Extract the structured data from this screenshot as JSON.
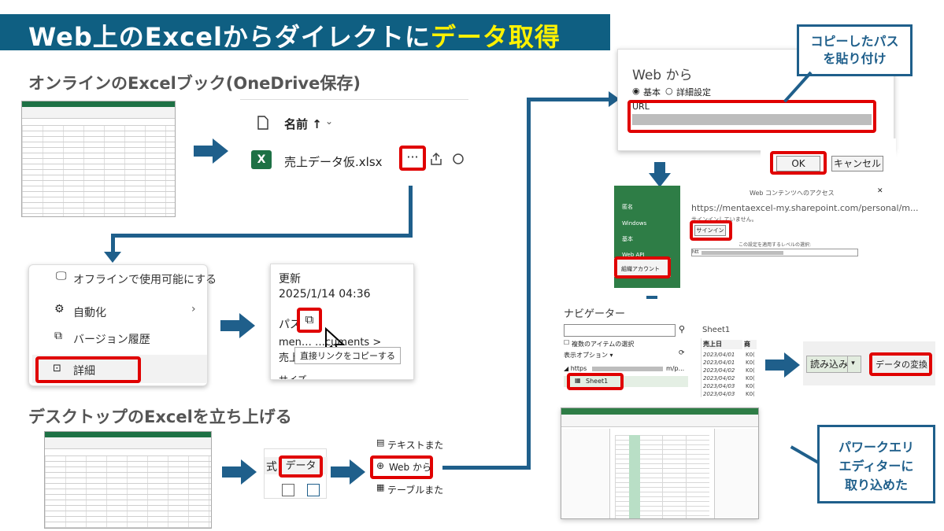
{
  "banner": {
    "title_part1": "Web上のExcelからダイレクトに",
    "title_part2": "データ取得"
  },
  "section1": {
    "title": "オンラインのExcelブック(OneDrive保存)"
  },
  "section2": {
    "title": "デスクトップのExcelを立ち上げる"
  },
  "onedrive": {
    "name_header": "名前 ↑",
    "file_name": "売上データ仮.xlsx",
    "more_button": "···"
  },
  "context_menu": {
    "items": [
      "オフラインで使用可能にする",
      "自動化",
      "バージョン履歴",
      "詳細"
    ]
  },
  "details": {
    "updated_label": "更新",
    "updated_value": "2025/1/14 04:36",
    "path_label": "パス",
    "path_value": "men…    …cuments >",
    "file_name_partial": "売上",
    "tooltip": "直接リンクをコピーする",
    "size_label": "サイズ"
  },
  "desktop_excel": {
    "style_label": "式",
    "data_tab": "データ",
    "menu": [
      "テキストまたは",
      "Web から",
      "テーブルまたは範"
    ]
  },
  "web_dialog": {
    "title": "Web から",
    "radio_basic": "基本",
    "radio_advanced": "詳細設定",
    "url_label": "URL",
    "ok_button": "OK",
    "cancel_button": "キャンセル"
  },
  "callout_paste": "コピーしたパス\nを貼り付け",
  "access_dialog": {
    "title": "Web コンテンツへのアクセス",
    "url": "https://mentaexcel-my.sharepoint.com/personal/m...",
    "signin_text": "サインインしていません。",
    "signin_button": "サインイン",
    "level_label": "この設定を適用するレベルの選択:",
    "level_value": "htt",
    "sidebar": [
      "匿名",
      "Windows",
      "基本",
      "Web API",
      "組織アカウント"
    ]
  },
  "navigator": {
    "title": "ナビゲーター",
    "multi_select": "複数のアイテムの選択",
    "display_options": "表示オプション ▾",
    "url_node": "https",
    "url_node_suffix": "m/p...",
    "sheet_item": "Sheet1",
    "preview_title": "Sheet1",
    "col_header": "売上日",
    "col_header2": "商",
    "dates": [
      "2023/04/01",
      "2023/04/01",
      "2023/04/02",
      "2023/04/02",
      "2023/04/03",
      "2023/04/03"
    ],
    "codes": [
      "K0(",
      "K0(",
      "K0(",
      "K0(",
      "K0(",
      "K0("
    ],
    "load_button": "読み込み",
    "transform_button": "データの変換"
  },
  "callout_pq": "パワークエリ\nエディターに\n取り込めた",
  "colors": {
    "banner": "#0f5f82",
    "accent_yellow": "#fff200",
    "arrow": "#1f5f8b",
    "highlight_red": "#e00000",
    "excel_green": "#1e7145"
  }
}
